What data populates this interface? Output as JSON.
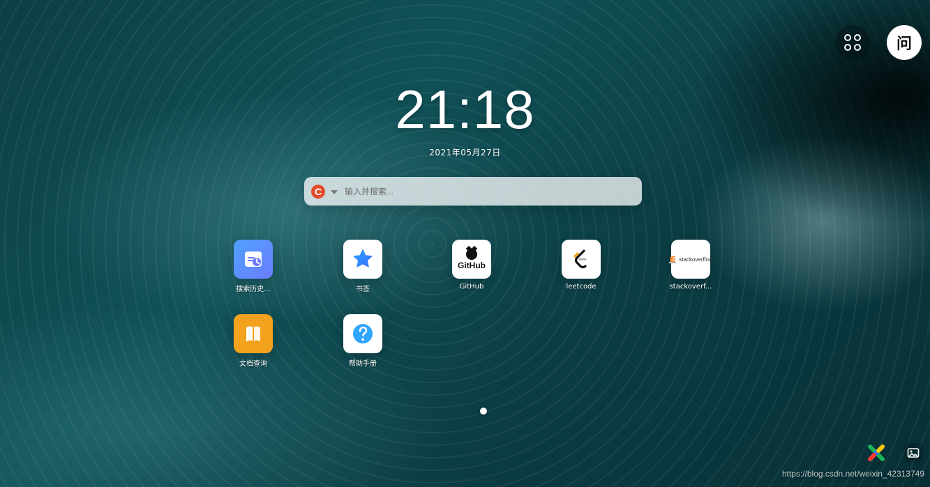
{
  "top_right": {
    "apps_icon": "grid-icon",
    "avatar_text": "问"
  },
  "clock": {
    "time": "21:18",
    "date": "2021年05月27日"
  },
  "search": {
    "engine_icon": "c-icon",
    "placeholder": "输入并搜索..."
  },
  "shortcuts": [
    {
      "label": "搜索历史...",
      "icon": "history-icon"
    },
    {
      "label": "书签",
      "icon": "star-icon"
    },
    {
      "label": "GitHub",
      "icon": "github-icon",
      "tile_text": "GitHub"
    },
    {
      "label": "leetcode",
      "icon": "leetcode-icon"
    },
    {
      "label": "stackoverf...",
      "icon": "stackoverflow-icon",
      "tile_text": "stackoverflow"
    },
    {
      "label": "文档查询",
      "icon": "book-icon"
    },
    {
      "label": "帮助手册",
      "icon": "help-icon"
    }
  ],
  "bottom_right": {
    "watermark": "https://blog.csdn.net/weixin_42313749",
    "left_icon": "brand-x-icon",
    "right_icon": "wallpaper-icon"
  },
  "colors": {
    "accent_red": "#e24b2b",
    "accent_orange": "#f3a21d",
    "accent_blue": "#4ea2ff"
  }
}
